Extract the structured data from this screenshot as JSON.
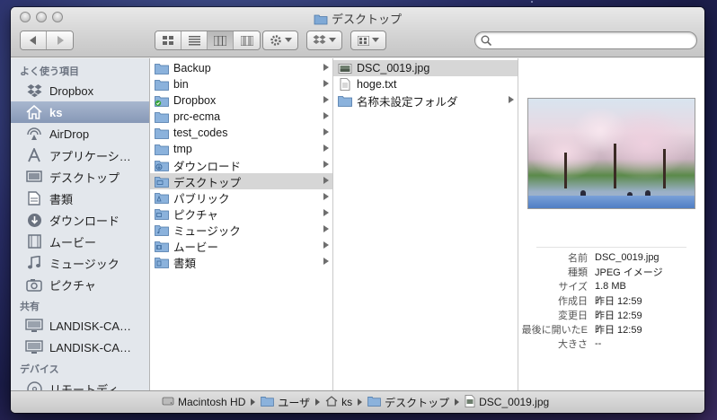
{
  "window": {
    "title": "デスクトップ"
  },
  "toolbar": {
    "search_placeholder": ""
  },
  "sidebar": {
    "sections": [
      {
        "header": "よく使う項目",
        "items": [
          {
            "label": "Dropbox",
            "icon": "dropbox-icon"
          },
          {
            "label": "ks",
            "icon": "home-icon",
            "selected": true
          },
          {
            "label": "AirDrop",
            "icon": "airdrop-icon"
          },
          {
            "label": "アプリケーシ…",
            "icon": "applications-icon"
          },
          {
            "label": "デスクトップ",
            "icon": "desktop-icon"
          },
          {
            "label": "書類",
            "icon": "documents-icon"
          },
          {
            "label": "ダウンロード",
            "icon": "downloads-icon"
          },
          {
            "label": "ムービー",
            "icon": "movies-icon"
          },
          {
            "label": "ミュージック",
            "icon": "music-icon"
          },
          {
            "label": "ピクチャ",
            "icon": "pictures-icon"
          }
        ]
      },
      {
        "header": "共有",
        "items": [
          {
            "label": "LANDISK-CA…",
            "icon": "network-computer-icon"
          },
          {
            "label": "LANDISK-CA…",
            "icon": "network-computer-icon"
          }
        ]
      },
      {
        "header": "デバイス",
        "items": [
          {
            "label": "リモートディ…",
            "icon": "remote-disc-icon"
          }
        ]
      }
    ]
  },
  "column1": [
    {
      "label": "Backup",
      "kind": "folder",
      "arrow": true
    },
    {
      "label": "bin",
      "kind": "folder",
      "arrow": true
    },
    {
      "label": "Dropbox",
      "kind": "dropbox-folder",
      "arrow": true
    },
    {
      "label": "prc-ecma",
      "kind": "folder",
      "arrow": true
    },
    {
      "label": "test_codes",
      "kind": "folder",
      "arrow": true
    },
    {
      "label": "tmp",
      "kind": "folder",
      "arrow": true
    },
    {
      "label": "ダウンロード",
      "kind": "downloads-folder",
      "arrow": true
    },
    {
      "label": "デスクトップ",
      "kind": "desktop-folder",
      "arrow": true,
      "selected": true
    },
    {
      "label": "パブリック",
      "kind": "public-folder",
      "arrow": true
    },
    {
      "label": "ピクチャ",
      "kind": "pictures-folder",
      "arrow": true
    },
    {
      "label": "ミュージック",
      "kind": "music-folder",
      "arrow": true
    },
    {
      "label": "ムービー",
      "kind": "movies-folder",
      "arrow": true
    },
    {
      "label": "書類",
      "kind": "documents-folder",
      "arrow": true
    }
  ],
  "column2": [
    {
      "label": "DSC_0019.jpg",
      "kind": "image-file",
      "arrow": false,
      "selected": true
    },
    {
      "label": "hoge.txt",
      "kind": "text-file",
      "arrow": false
    },
    {
      "label": "名称未設定フォルダ",
      "kind": "folder",
      "arrow": true
    }
  ],
  "preview": {
    "info": [
      {
        "key": "名前",
        "value": "DSC_0019.jpg"
      },
      {
        "key": "種類",
        "value": "JPEG イメージ"
      },
      {
        "key": "サイズ",
        "value": "1.8 MB"
      },
      {
        "key": "作成日",
        "value": "昨日 12:59"
      },
      {
        "key": "変更日",
        "value": "昨日 12:59"
      },
      {
        "key": "最後に開いたE",
        "value": "昨日 12:59"
      },
      {
        "key": "大きさ",
        "value": "--"
      }
    ]
  },
  "pathbar": [
    {
      "label": "Macintosh HD",
      "icon": "hard-drive-icon"
    },
    {
      "label": "ユーザ",
      "icon": "folder-icon"
    },
    {
      "label": "ks",
      "icon": "home-icon"
    },
    {
      "label": "デスクトップ",
      "icon": "folder-icon"
    },
    {
      "label": "DSC_0019.jpg",
      "icon": "file-icon"
    }
  ],
  "colors": {
    "sidebar_selected": "#8798b6",
    "folder_blue": "#7fa9d6",
    "row_selected": "#d6d6d6"
  }
}
